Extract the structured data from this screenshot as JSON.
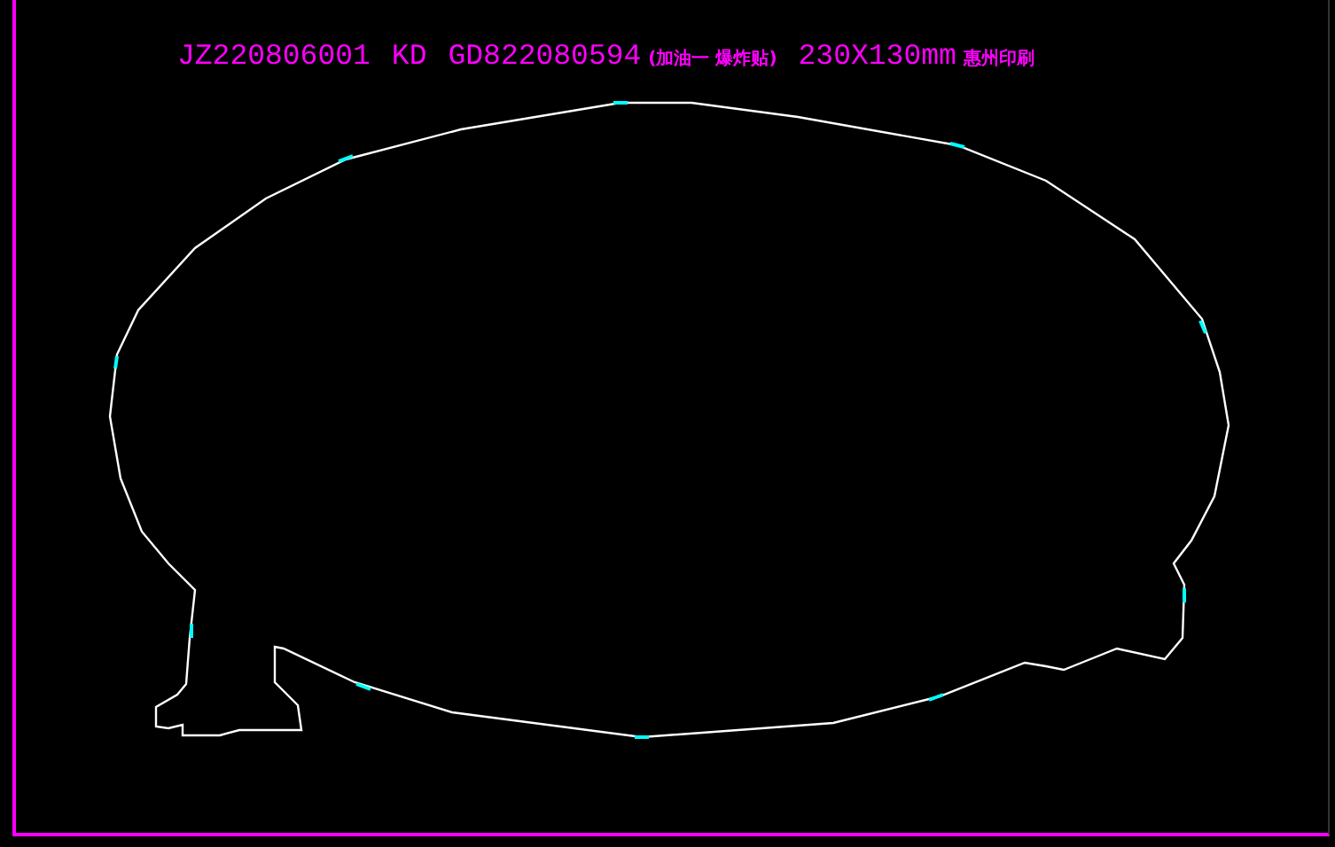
{
  "title": {
    "parts": [
      {
        "kind": "code",
        "text": "JZ220806001"
      },
      {
        "kind": "code",
        "text": "KD"
      },
      {
        "kind": "code",
        "text": "GD822080594"
      },
      {
        "kind": "note",
        "text": "(加油一 爆炸贴)"
      },
      {
        "kind": "code",
        "text": "230X130mm"
      },
      {
        "kind": "note",
        "text": "惠州印刷"
      }
    ]
  }
}
